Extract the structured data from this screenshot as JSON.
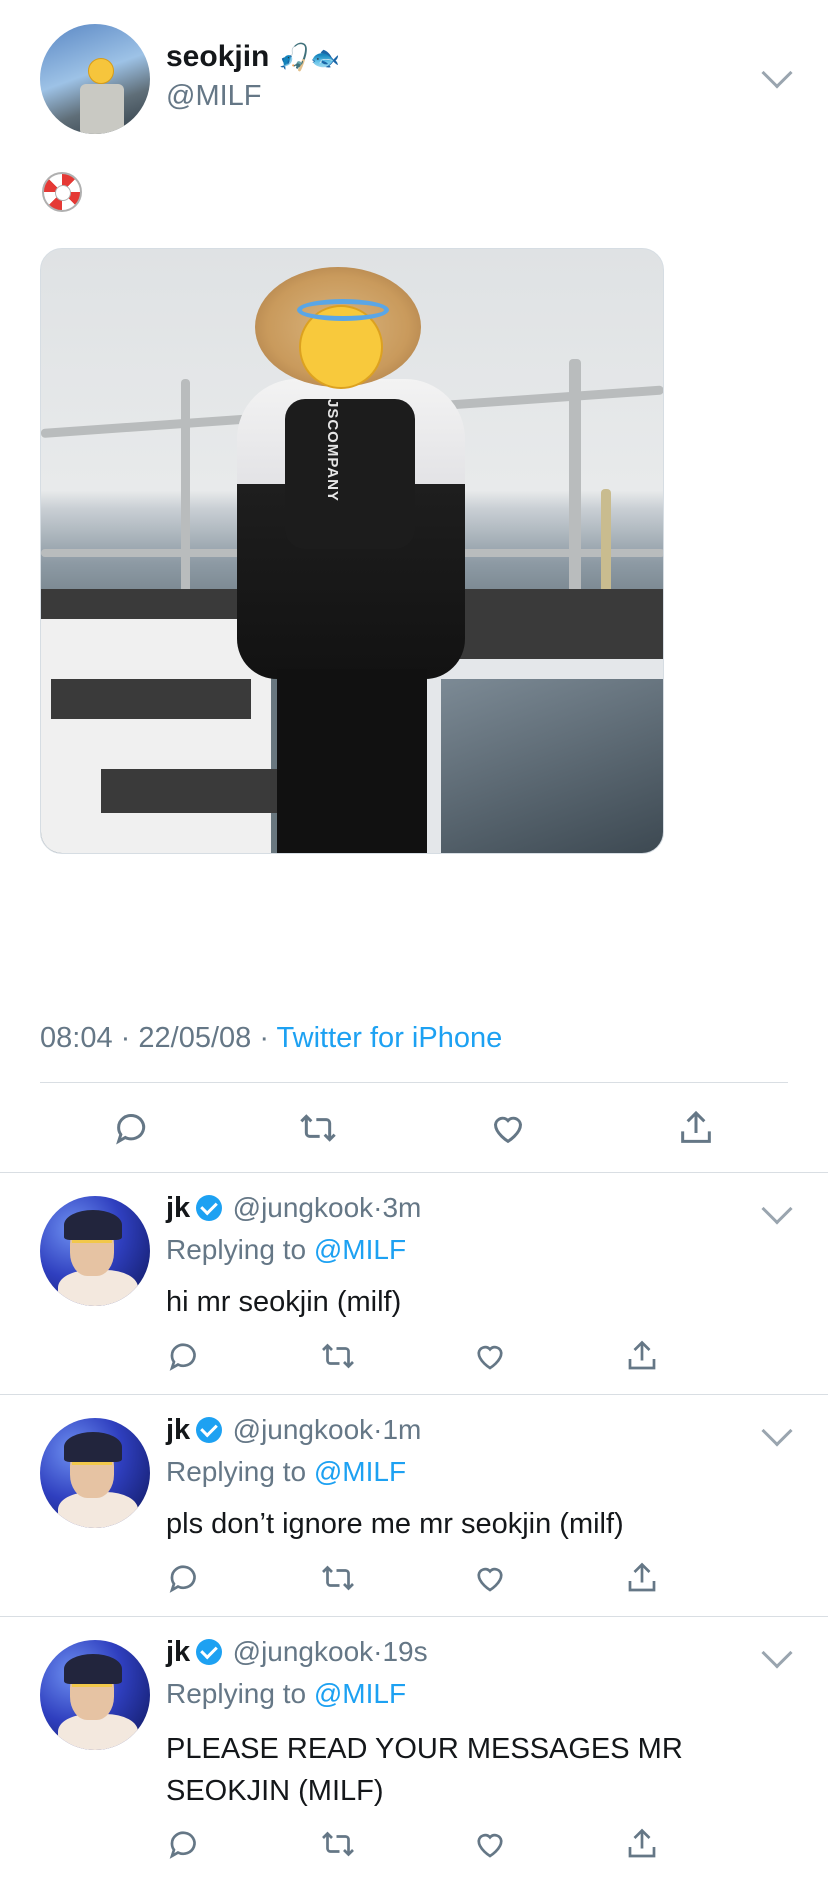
{
  "tweet": {
    "author_name": "seokjin",
    "author_emoji": "🎣",
    "author_emoji2": "🐟",
    "author_handle": "@MILF",
    "body_emoji": "lifebuoy-icon",
    "time": "08:04",
    "date": "22/05/08",
    "source": "Twitter for iPhone",
    "separator": "·"
  },
  "replies": [
    {
      "name": "jk",
      "handle": "@jungkook",
      "separator": "·",
      "time": "3m",
      "replying_prefix": "Replying to",
      "replying_to": "@MILF",
      "text": "hi mr seokjin (milf)"
    },
    {
      "name": "jk",
      "handle": "@jungkook",
      "separator": "·",
      "time": "1m",
      "replying_prefix": "Replying to",
      "replying_to": "@MILF",
      "text": "pls don’t ignore me mr seokjin (milf)"
    },
    {
      "name": "jk",
      "handle": "@jungkook",
      "separator": "·",
      "time": "19s",
      "replying_prefix": "Replying to",
      "replying_to": "@MILF",
      "text": "PLEASE READ YOUR MESSAGES MR SEOKJIN (MILF)"
    }
  ],
  "photo_text": "JSCOMPANY",
  "colors": {
    "accent": "#1da1f2",
    "secondary_text": "#657786",
    "primary_text": "#14171a",
    "divider": "#d9dee3"
  }
}
